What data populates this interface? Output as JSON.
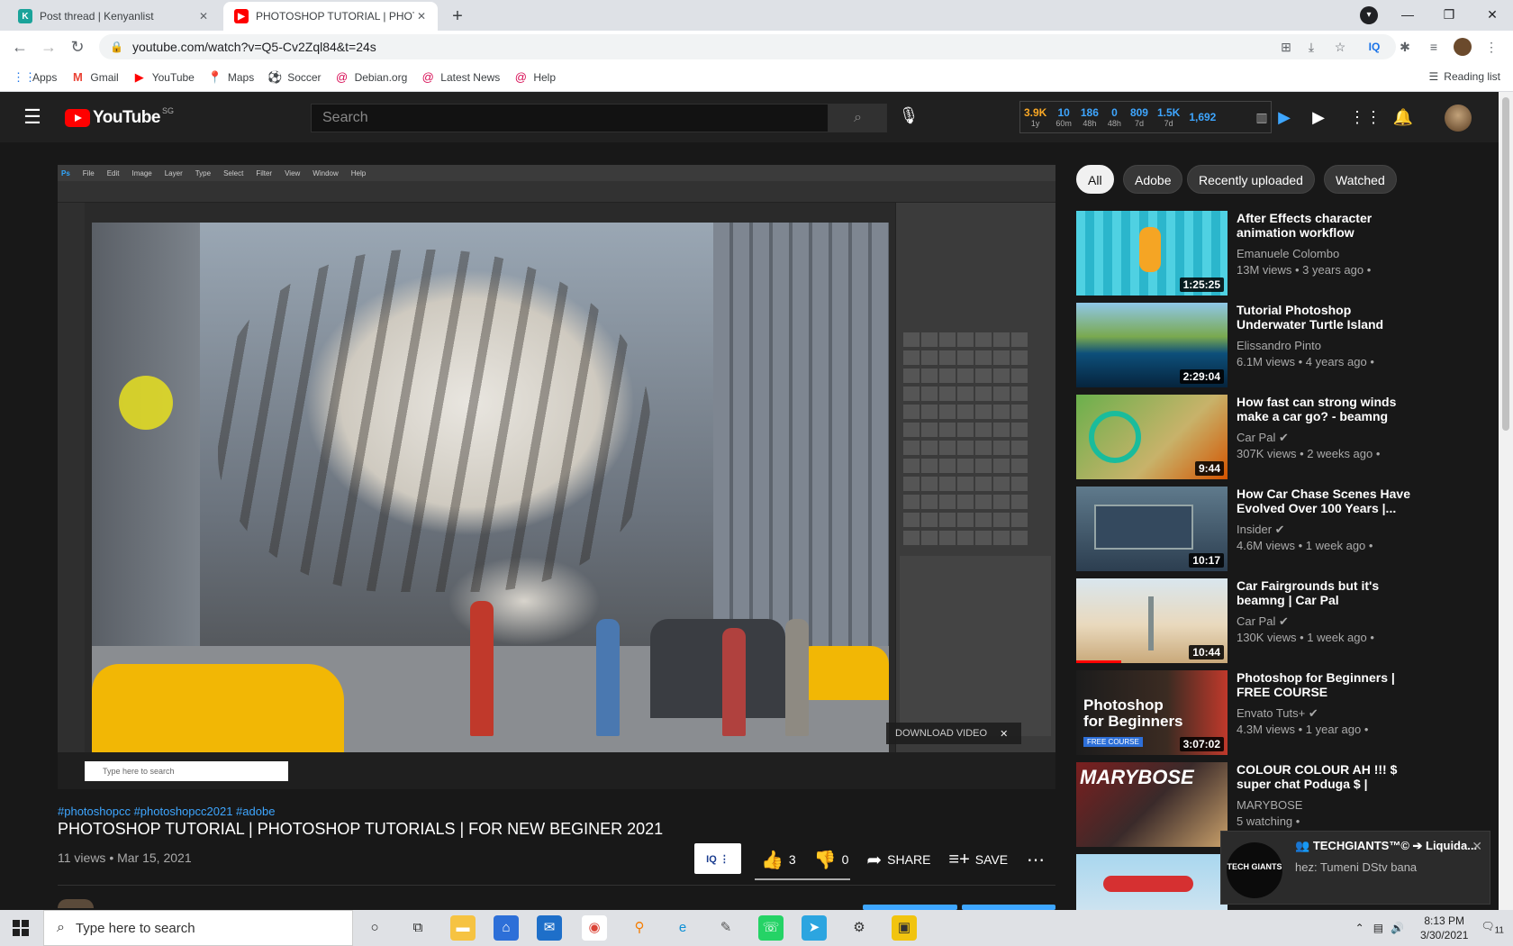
{
  "browser": {
    "tabs": [
      {
        "title": "Post thread | Kenyanlist",
        "favicon": "K"
      },
      {
        "title": "PHOTOSHOP TUTORIAL | PHOTO",
        "favicon": "yt"
      }
    ],
    "url": "youtube.com/watch?v=Q5-Cv2Zql84&t=24s",
    "bookmarks": [
      "Apps",
      "Gmail",
      "YouTube",
      "Maps",
      "Soccer",
      "Debian.org",
      "Latest News",
      "Help"
    ],
    "reading_list": "Reading list"
  },
  "masthead": {
    "logo": "YouTube",
    "region": "SG",
    "search_placeholder": "Search",
    "stats": [
      {
        "value": "3.9K",
        "label": "1y"
      },
      {
        "value": "10",
        "label": "60m"
      },
      {
        "value": "186",
        "label": "48h"
      },
      {
        "value": "0",
        "label": "48h"
      },
      {
        "value": "809",
        "label": "7d"
      },
      {
        "value": "1.5K",
        "label": "7d"
      },
      {
        "value": "1,692",
        "label": ""
      }
    ]
  },
  "player": {
    "ps_menu": [
      "Ps",
      "File",
      "Edit",
      "Image",
      "Layer",
      "Type",
      "Select",
      "Filter",
      "View",
      "Window",
      "Help"
    ],
    "ps_search": "Type here to search",
    "download_label": "DOWNLOAD VIDEO"
  },
  "video": {
    "hashtags": "#photoshopcc #photoshopcc2021 #adobe",
    "title": "PHOTOSHOP TUTORIAL | PHOTOSHOP TUTORIALS | FOR NEW BEGINER 2021",
    "views": "11 views • Mar 15, 2021",
    "likes": "3",
    "dislikes": "0",
    "like_ratio": 1.0,
    "share": "SHARE",
    "save": "SAVE"
  },
  "chips": [
    "All",
    "Adobe",
    "Recently uploaded",
    "Watched"
  ],
  "recommendations": [
    {
      "title": "After Effects character animation workflow",
      "channel": "Emanuele Colombo",
      "meta": "13M views • 3 years ago •",
      "duration": "1:25:25",
      "verified": false
    },
    {
      "title": "Tutorial Photoshop Underwater Turtle Island",
      "channel": "Elissandro Pinto",
      "meta": "6.1M views • 4 years ago •",
      "duration": "2:29:04",
      "verified": false
    },
    {
      "title": "How fast can strong winds make a car go? - beamng drive...",
      "channel": "Car Pal",
      "meta": "307K views • 2 weeks ago •",
      "duration": "9:44",
      "verified": true
    },
    {
      "title": "How Car Chase Scenes Have Evolved Over 100 Years |...",
      "channel": "Insider",
      "meta": "4.6M views • 1 week ago •",
      "duration": "10:17",
      "verified": true
    },
    {
      "title": "Car Fairgrounds but it's beamng | Car Pal",
      "channel": "Car Pal",
      "meta": "130K views • 1 week ago •",
      "duration": "10:44",
      "verified": true
    },
    {
      "title": "Photoshop for Beginners | FREE COURSE",
      "channel": "Envato Tuts+",
      "meta": "4.3M views • 1 year ago •",
      "duration": "3:07:02",
      "verified": true
    },
    {
      "title": "COLOUR COLOUR AH !!! $ super chat Poduga $ | #MARYBOSE |...",
      "channel": "MARYBOSE",
      "meta": "5 watching •",
      "duration": "",
      "verified": false
    }
  ],
  "notification": {
    "title": "TECHGIANTS™© ➔ Liquida...",
    "prefix": "hez:",
    "body": "Tumeni DStv bana",
    "avatar_text": "TECH GIANTS"
  },
  "taskbar": {
    "search": "Type here to search",
    "time": "8:13 PM",
    "date": "3/30/2021",
    "notifications": "11"
  }
}
